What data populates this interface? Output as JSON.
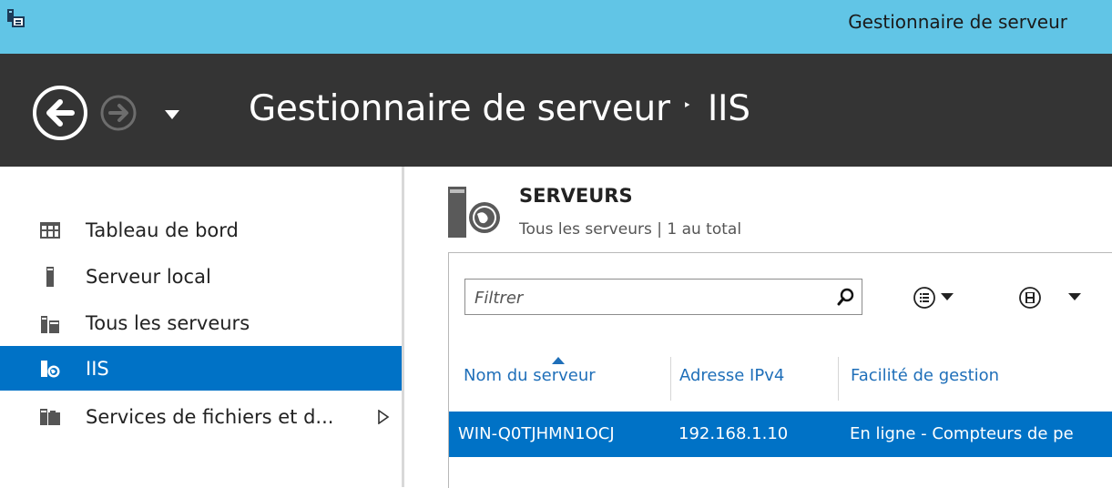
{
  "window": {
    "title": "Gestionnaire de serveur"
  },
  "header": {
    "breadcrumb_root": "Gestionnaire de serveur",
    "breadcrumb_separator": "‣",
    "breadcrumb_current": "IIS"
  },
  "sidebar": {
    "items": [
      {
        "label": "Tableau de bord",
        "icon": "dashboard-icon"
      },
      {
        "label": "Serveur local",
        "icon": "server-icon"
      },
      {
        "label": "Tous les serveurs",
        "icon": "servers-icon"
      },
      {
        "label": "IIS",
        "icon": "iis-icon",
        "selected": true
      },
      {
        "label": "Services de fichiers et d...",
        "icon": "file-services-icon",
        "has_submenu": true
      }
    ]
  },
  "servers": {
    "title": "SERVEURS",
    "subtitle": "Tous les serveurs | 1 au total",
    "filter_placeholder": "Filtrer",
    "columns": [
      "Nom du serveur",
      "Adresse IPv4",
      "Facilité de gestion"
    ],
    "sort_column": "Nom du serveur",
    "rows": [
      {
        "name": "WIN-Q0TJHMN1OCJ",
        "ipv4": "192.168.1.10",
        "manageability": "En ligne - Compteurs de pe"
      }
    ]
  },
  "colors": {
    "titlebar": "#61c5e6",
    "header": "#343434",
    "accent": "#0072c6",
    "link": "#1f6fb9"
  }
}
